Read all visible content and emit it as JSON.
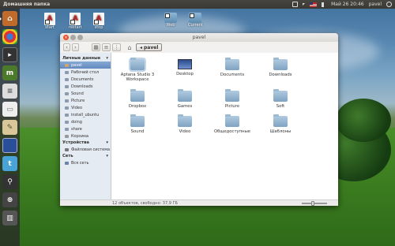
{
  "panel": {
    "title": "Домашняя папка",
    "clock": "Май 26 20:46",
    "user": "pavel"
  },
  "desktop": {
    "icons": [
      {
        "label": "start",
        "icon": "text-file-icon"
      },
      {
        "label": "restart",
        "icon": "text-file-icon"
      },
      {
        "label": "stop",
        "icon": "text-file-icon"
      },
      {
        "label": "Web",
        "icon": "folder-link-icon"
      },
      {
        "label": "Current",
        "icon": "folder-link-icon"
      }
    ]
  },
  "launcher": {
    "items": [
      "home-folder-icon",
      "chromium-icon",
      "terminal-icon",
      "unity-m-icon",
      "text-editor-icon",
      "document-icon",
      "pen-icon",
      "workspace-switcher-icon",
      "twitter-icon",
      "search-icon",
      "zoom-icon",
      "trash-icon"
    ]
  },
  "window": {
    "title": "pavel",
    "crumb": "pavel",
    "sidebar": {
      "sections": [
        {
          "header": "Личные данные",
          "items": [
            "pavel",
            "Рабочий стол",
            "Documents",
            "Downloads",
            "Sound",
            "Picture",
            "Video",
            "install_ubuntu",
            "doing",
            "share",
            "Корзина"
          ]
        },
        {
          "header": "Устройства",
          "items": [
            "Файловая система"
          ]
        },
        {
          "header": "Сеть",
          "items": [
            "Вся сеть"
          ]
        }
      ]
    },
    "files": [
      {
        "name": "Aptana Studio 3 Workspace",
        "kind": "folder"
      },
      {
        "name": "Desktop",
        "kind": "desktop"
      },
      {
        "name": "Documents",
        "kind": "folder"
      },
      {
        "name": "Downloads",
        "kind": "folder"
      },
      {
        "name": "Dropbox",
        "kind": "folder"
      },
      {
        "name": "Games",
        "kind": "folder"
      },
      {
        "name": "Picture",
        "kind": "folder"
      },
      {
        "name": "Soft",
        "kind": "folder"
      },
      {
        "name": "Sound",
        "kind": "folder"
      },
      {
        "name": "Video",
        "kind": "folder"
      },
      {
        "name": "Общедоступные",
        "kind": "folder"
      },
      {
        "name": "Шаблоны",
        "kind": "folder"
      }
    ],
    "status": "12 объектов, свободно: 37,9 ГБ"
  }
}
